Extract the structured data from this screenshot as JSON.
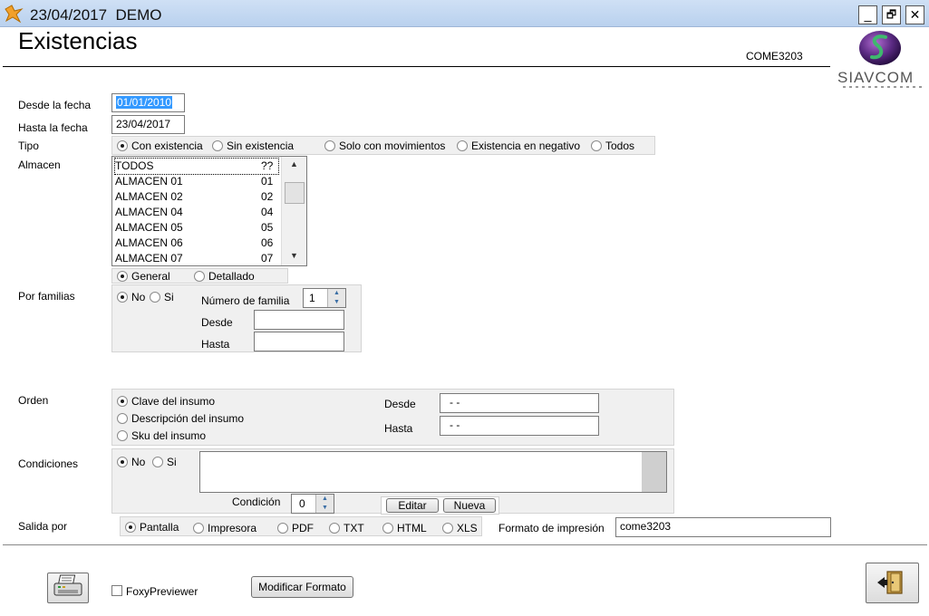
{
  "window": {
    "title": "23/04/2017  DEMO",
    "minimize": "_",
    "restore": "🗗",
    "close": "✕"
  },
  "header": {
    "title": "Existencias",
    "form_code": "COME3203",
    "logo_text": "SIAVCOM"
  },
  "fields": {
    "desde_fecha_label": "Desde la fecha",
    "desde_fecha_value": "01/01/2010",
    "hasta_fecha_label": "Hasta la fecha",
    "hasta_fecha_value": "23/04/2017",
    "tipo_label": "Tipo",
    "almacen_label": "Almacen",
    "por_familias_label": "Por familias",
    "orden_label": "Orden",
    "condiciones_label": "Condiciones",
    "salida_label": "Salida por"
  },
  "tipo": {
    "options": [
      "Con existencia",
      "Sin existencia",
      "Solo con movimientos",
      "Existencia en negativo",
      "Todos"
    ],
    "selected": 0
  },
  "almacen": {
    "items": [
      {
        "name": "TODOS",
        "code": "??"
      },
      {
        "name": "ALMACEN 01",
        "code": "01"
      },
      {
        "name": "ALMACEN 02",
        "code": "02"
      },
      {
        "name": "ALMACEN 04",
        "code": "04"
      },
      {
        "name": "ALMACEN 05",
        "code": "05"
      },
      {
        "name": "ALMACEN 06",
        "code": "06"
      },
      {
        "name": "ALMACEN 07",
        "code": "07"
      }
    ]
  },
  "detalle": {
    "options": [
      "General",
      "Detallado"
    ],
    "selected": 0
  },
  "familias": {
    "options": [
      "No",
      "Si"
    ],
    "selected": 0,
    "numero_label": "Número de familia",
    "numero_value": "1",
    "desde_label": "Desde",
    "desde_value": "",
    "hasta_label": "Hasta",
    "hasta_value": ""
  },
  "orden": {
    "options": [
      "Clave del insumo",
      "Descripción del insumo",
      "Sku del insumo"
    ],
    "selected": 0,
    "desde_label": "Desde",
    "desde_value": "- -",
    "hasta_label": "Hasta",
    "hasta_value": "- -"
  },
  "condiciones": {
    "options": [
      "No",
      "Si"
    ],
    "selected": 0,
    "condicion_label": "Condición",
    "condicion_value": "0",
    "editar_label": "Editar",
    "nueva_label": "Nueva"
  },
  "salida": {
    "options": [
      "Pantalla",
      "Impresora",
      "PDF",
      "TXT",
      "HTML",
      "XLS"
    ],
    "selected": 0,
    "formato_label": "Formato de impresión",
    "formato_value": "come3203"
  },
  "footer": {
    "foxy_label": "FoxyPreviewer",
    "foxy_checked": false,
    "modificar_label": "Modificar Formato"
  }
}
